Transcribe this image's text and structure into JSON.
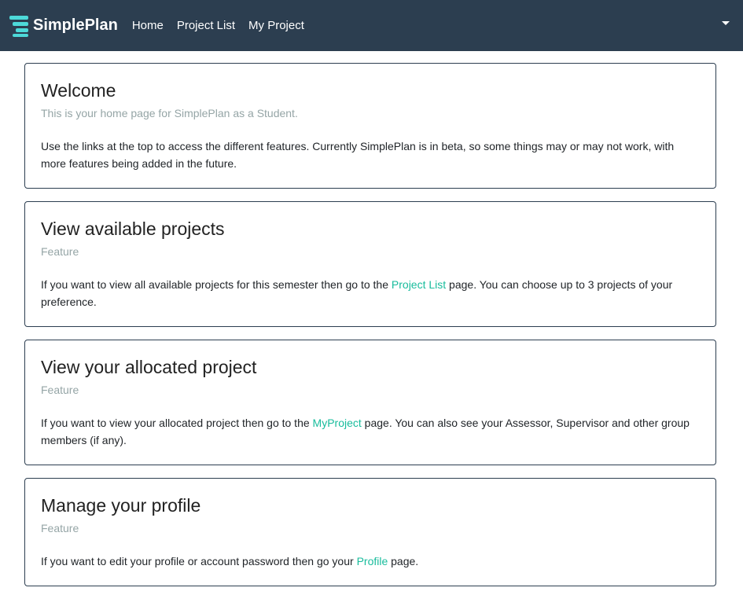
{
  "navbar": {
    "brand": "SimplePlan",
    "links": [
      "Home",
      "Project List",
      "My Project"
    ]
  },
  "cards": [
    {
      "title": "Welcome",
      "subtitle": "This is your home page for SimplePlan as a Student.",
      "text_before": "Use the links at the top to access the different features. Currently SimplePlan is in beta, so some things may or may not work, with more features being added in the future.",
      "link": "",
      "text_after": ""
    },
    {
      "title": "View available projects",
      "subtitle": "Feature",
      "text_before": "If you want to view all available projects for this semester then go to the ",
      "link": "Project List",
      "text_after": " page. You can choose up to 3 projects of your preference."
    },
    {
      "title": "View your allocated project",
      "subtitle": "Feature",
      "text_before": "If you want to view your allocated project then go to the ",
      "link": "MyProject",
      "text_after": " page. You can also see your Assessor, Supervisor and other group members (if any)."
    },
    {
      "title": "Manage your profile",
      "subtitle": "Feature",
      "text_before": "If you want to edit your profile or account password then go your ",
      "link": "Profile",
      "text_after": " page."
    }
  ],
  "colors": {
    "navbar": "#2c3e50",
    "accent": "#18bc9c",
    "muted": "#95a5a6"
  }
}
